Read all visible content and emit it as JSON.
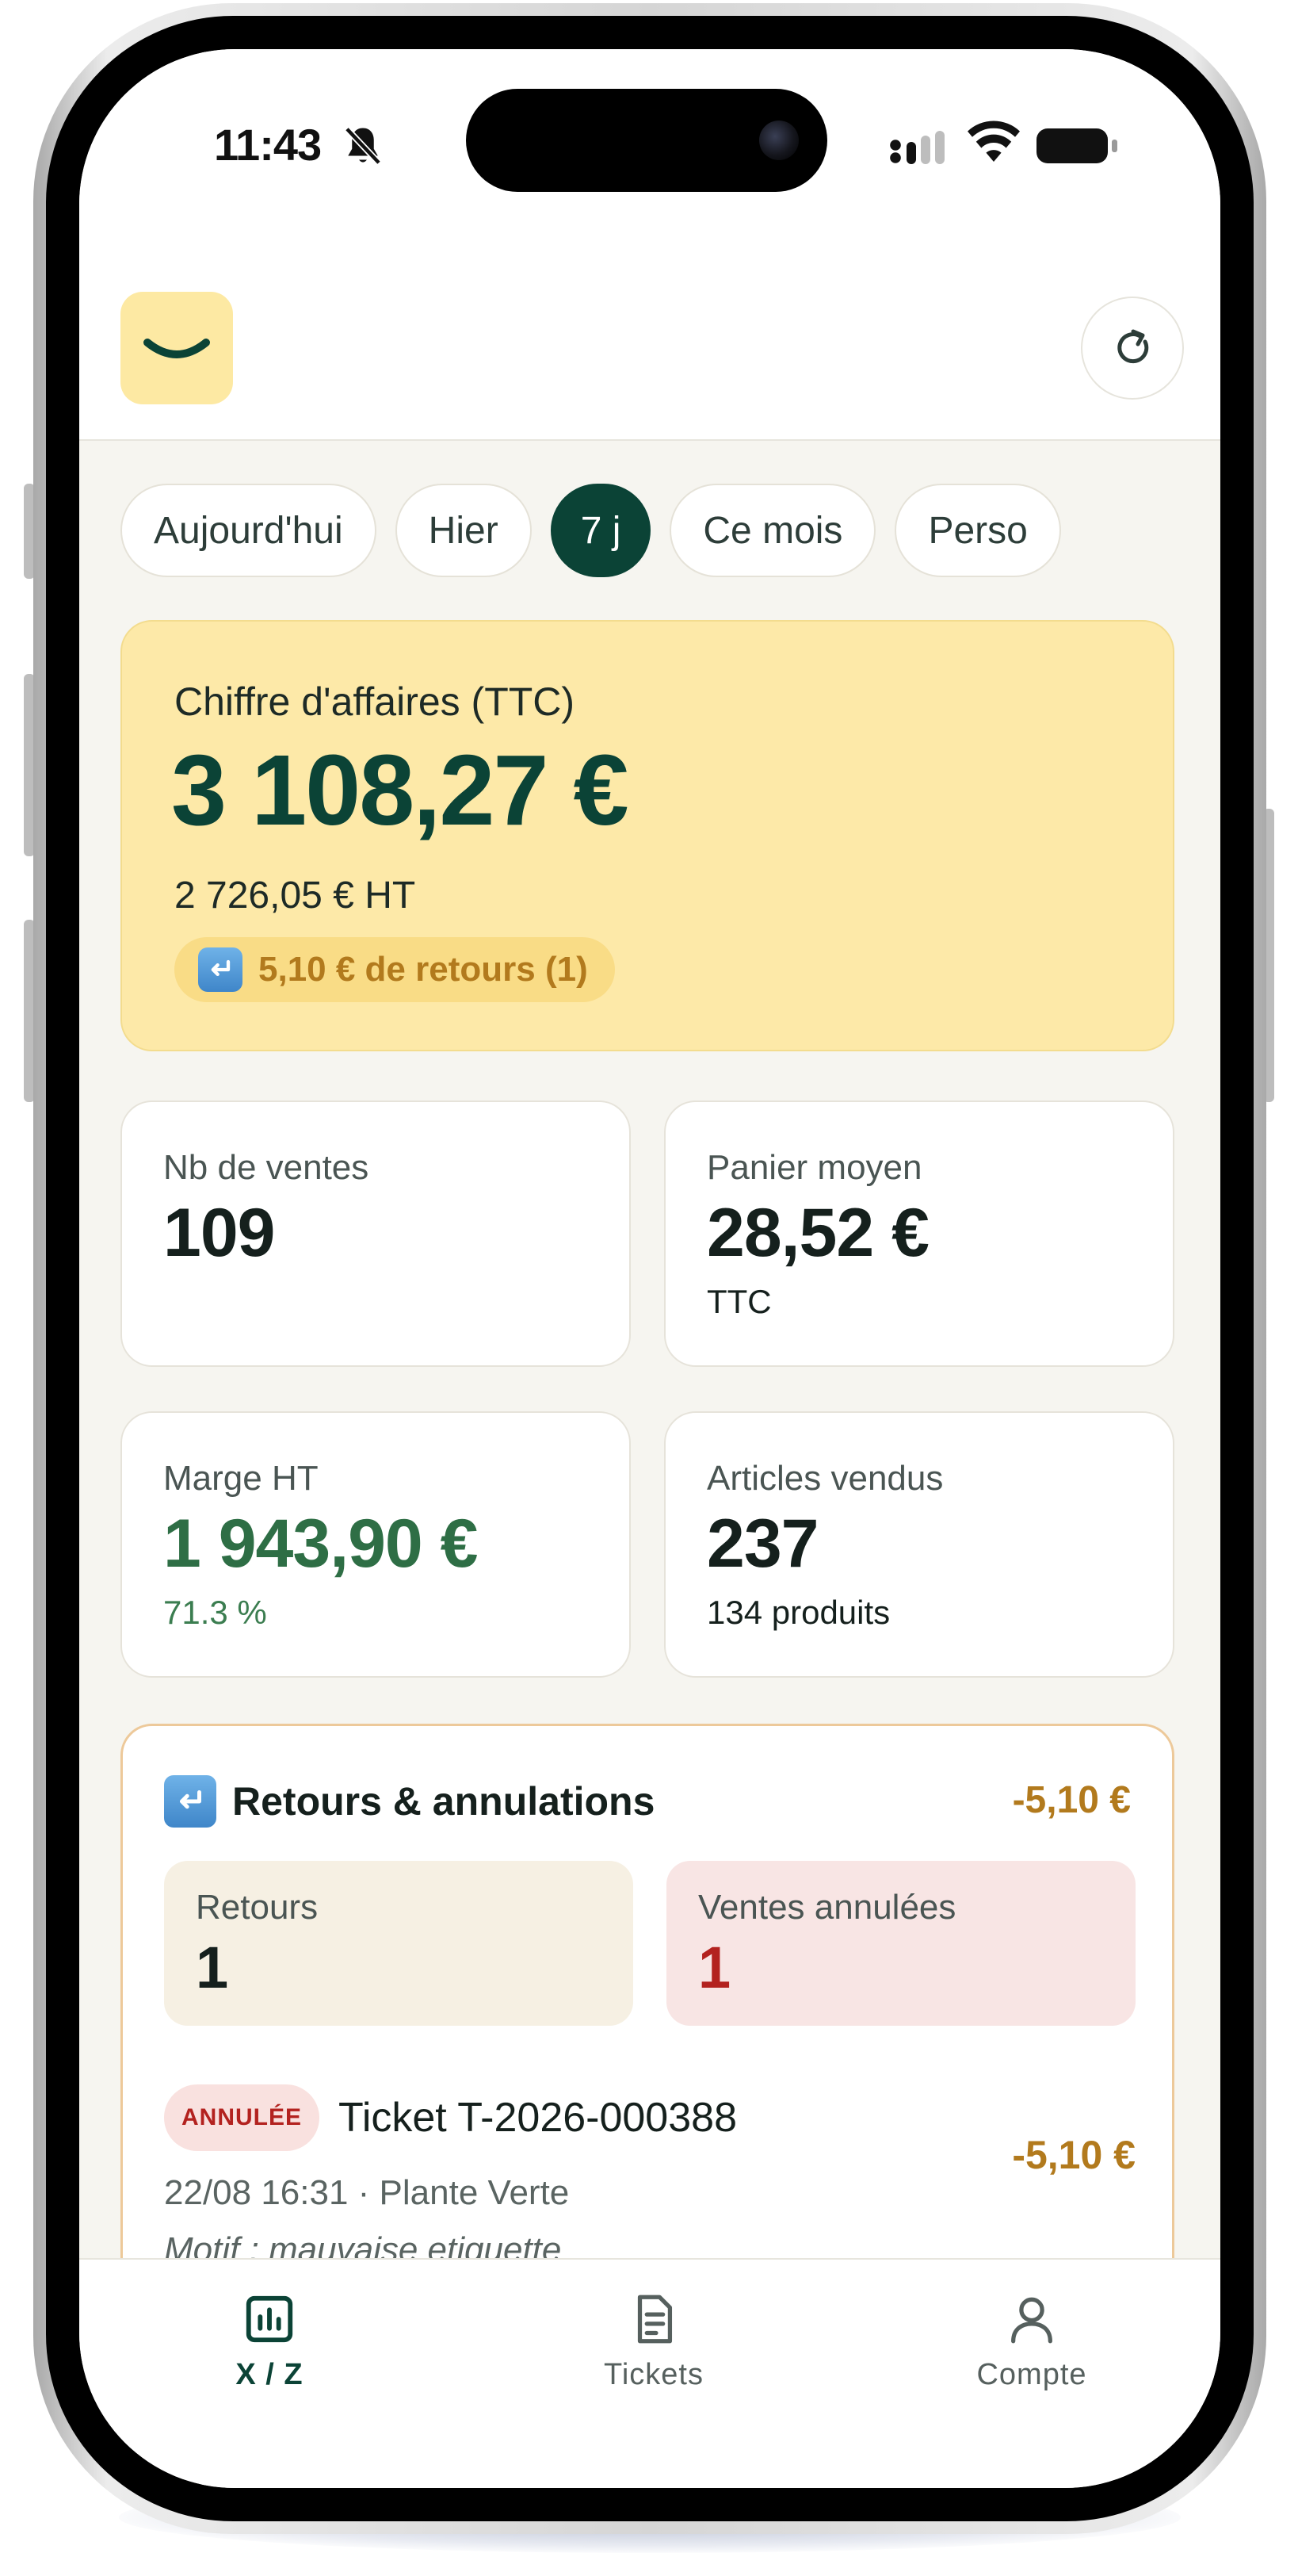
{
  "status_bar": {
    "time": "11:43",
    "icons": [
      "bell-slash-icon",
      "cellular-signal-icon",
      "wifi-icon",
      "battery-icon"
    ]
  },
  "header": {
    "logo_icon": "smile-icon",
    "refresh_icon": "refresh-icon"
  },
  "periods": [
    {
      "label": "Aujourd'hui",
      "active": false
    },
    {
      "label": "Hier",
      "active": false
    },
    {
      "label": "7 j",
      "active": true
    },
    {
      "label": "Ce mois",
      "active": false
    },
    {
      "label": "Perso",
      "active": false
    }
  ],
  "revenue": {
    "label": "Chiffre d'affaires (TTC)",
    "amount": "3 108,27 €",
    "ht": "2 726,05 € HT",
    "returns_text": "5,10 € de retours (1)"
  },
  "stats": {
    "sales": {
      "label": "Nb de ventes",
      "value": "109"
    },
    "basket": {
      "label": "Panier moyen",
      "value": "28,52 €",
      "sub": "TTC"
    },
    "margin": {
      "label": "Marge HT",
      "value": "1 943,90 €",
      "sub": "71.3 %"
    },
    "items": {
      "label": "Articles vendus",
      "value": "237",
      "sub": "134 produits"
    }
  },
  "returns_section": {
    "title": "Retours & annulations",
    "total": "-5,10 €",
    "returns": {
      "label": "Retours",
      "value": "1"
    },
    "cancelled": {
      "label": "Ventes annulées",
      "value": "1"
    },
    "ticket": {
      "badge": "ANNULÉE",
      "title": "Ticket T-2026-000388",
      "meta": "22/08 16:31 · Plante Verte",
      "reason": "Motif : mauvaise etiquette",
      "amount": "-5,10 €"
    }
  },
  "tabs": [
    {
      "label": "X / Z",
      "icon": "bar-chart-icon",
      "active": true
    },
    {
      "label": "Tickets",
      "icon": "document-icon",
      "active": false
    },
    {
      "label": "Compte",
      "icon": "user-icon",
      "active": false
    }
  ],
  "colors": {
    "brand_dark_green": "#0b4336",
    "brand_yellow": "#fde9a8",
    "accent_orange": "#b27a1d",
    "danger_red": "#b3221f",
    "success_green": "#2e6e45",
    "background": "#f6f5f0"
  }
}
